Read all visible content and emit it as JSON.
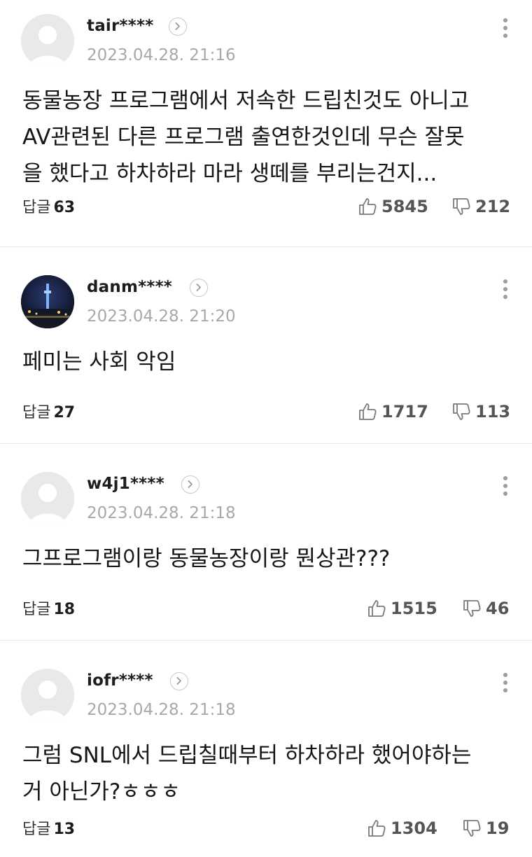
{
  "comments": [
    {
      "username": "tair****",
      "timestamp": "2023.04.28. 21:16",
      "body": "동물농장 프로그램에서 저속한 드립친것도 아니고\nAV관련된 다른 프로그램 출연한것인데 무슨 잘못\n을 했다고 하차하라 마라 생떼를 부리는건지...",
      "reply_label": "답글",
      "reply_count": "63",
      "likes": "5845",
      "dislikes": "212",
      "avatar": "default-person"
    },
    {
      "username": "danm****",
      "timestamp": "2023.04.28. 21:20",
      "body": "페미는 사회 악임",
      "reply_label": "답글",
      "reply_count": "27",
      "likes": "1717",
      "dislikes": "113",
      "avatar": "night-city-photo"
    },
    {
      "username": "w4j1****",
      "timestamp": "2023.04.28. 21:18",
      "body": "그프로그램이랑 동물농장이랑 뭔상관???",
      "reply_label": "답글",
      "reply_count": "18",
      "likes": "1515",
      "dislikes": "46",
      "avatar": "default-person"
    },
    {
      "username": "iofr****",
      "timestamp": "2023.04.28. 21:18",
      "body": "그럼 SNL에서 드립칠때부터 하차하라 했어야하는\n거 아닌가?ㅎㅎㅎ",
      "reply_label": "답글",
      "reply_count": "13",
      "likes": "1304",
      "dislikes": "19",
      "avatar": "default-person"
    }
  ],
  "icons": {
    "like": "thumbs-up-icon",
    "dislike": "thumbs-down-icon",
    "more": "more-vertical-icon",
    "profile": "chevron-right-icon"
  },
  "colors": {
    "timestamp": "#a8a8a8",
    "divider": "#e6e6e6",
    "icon": "#9c9c9c"
  }
}
